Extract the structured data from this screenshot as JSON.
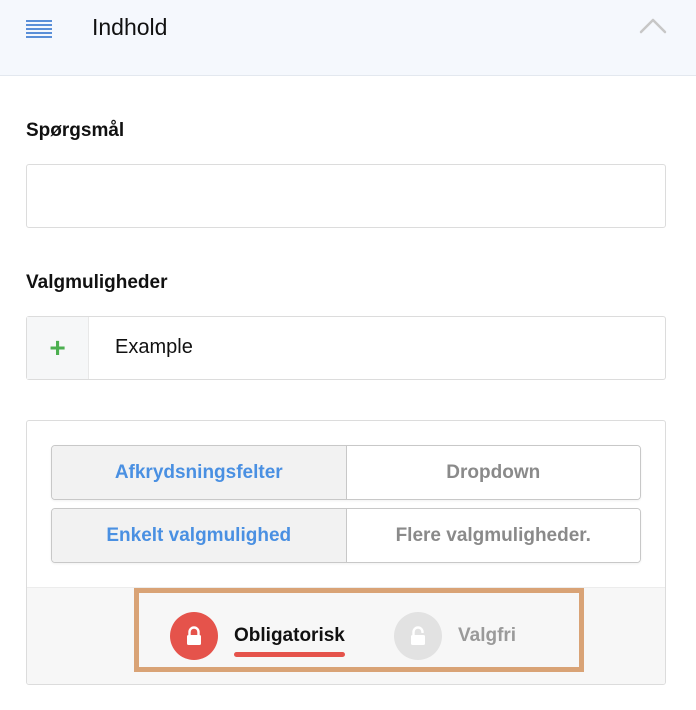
{
  "header": {
    "title": "Indhold",
    "menu_icon": "list-lines-icon",
    "collapse_icon": "chevron-up-icon"
  },
  "question": {
    "label": "Spørgsmål",
    "value": "",
    "placeholder": ""
  },
  "options": {
    "label": "Valgmuligheder",
    "items": [
      {
        "add_icon": "+",
        "text": "Example"
      }
    ]
  },
  "settings": {
    "type_toggle": [
      {
        "label": "Afkrydsningsfelter",
        "active": true
      },
      {
        "label": "Dropdown",
        "active": false
      }
    ],
    "selection_toggle": [
      {
        "label": "Enkelt valgmulighed",
        "active": true
      },
      {
        "label": "Flere valgmuligheder.",
        "active": false
      }
    ],
    "requirement": {
      "obligatory_label": "Obligatorisk",
      "optional_label": "Valgfri",
      "selected": "Obligatorisk"
    }
  },
  "colors": {
    "accent_blue": "#4a90e2",
    "required_red": "#e5534b",
    "add_green": "#4caf50",
    "highlight_border": "#d9a376"
  }
}
